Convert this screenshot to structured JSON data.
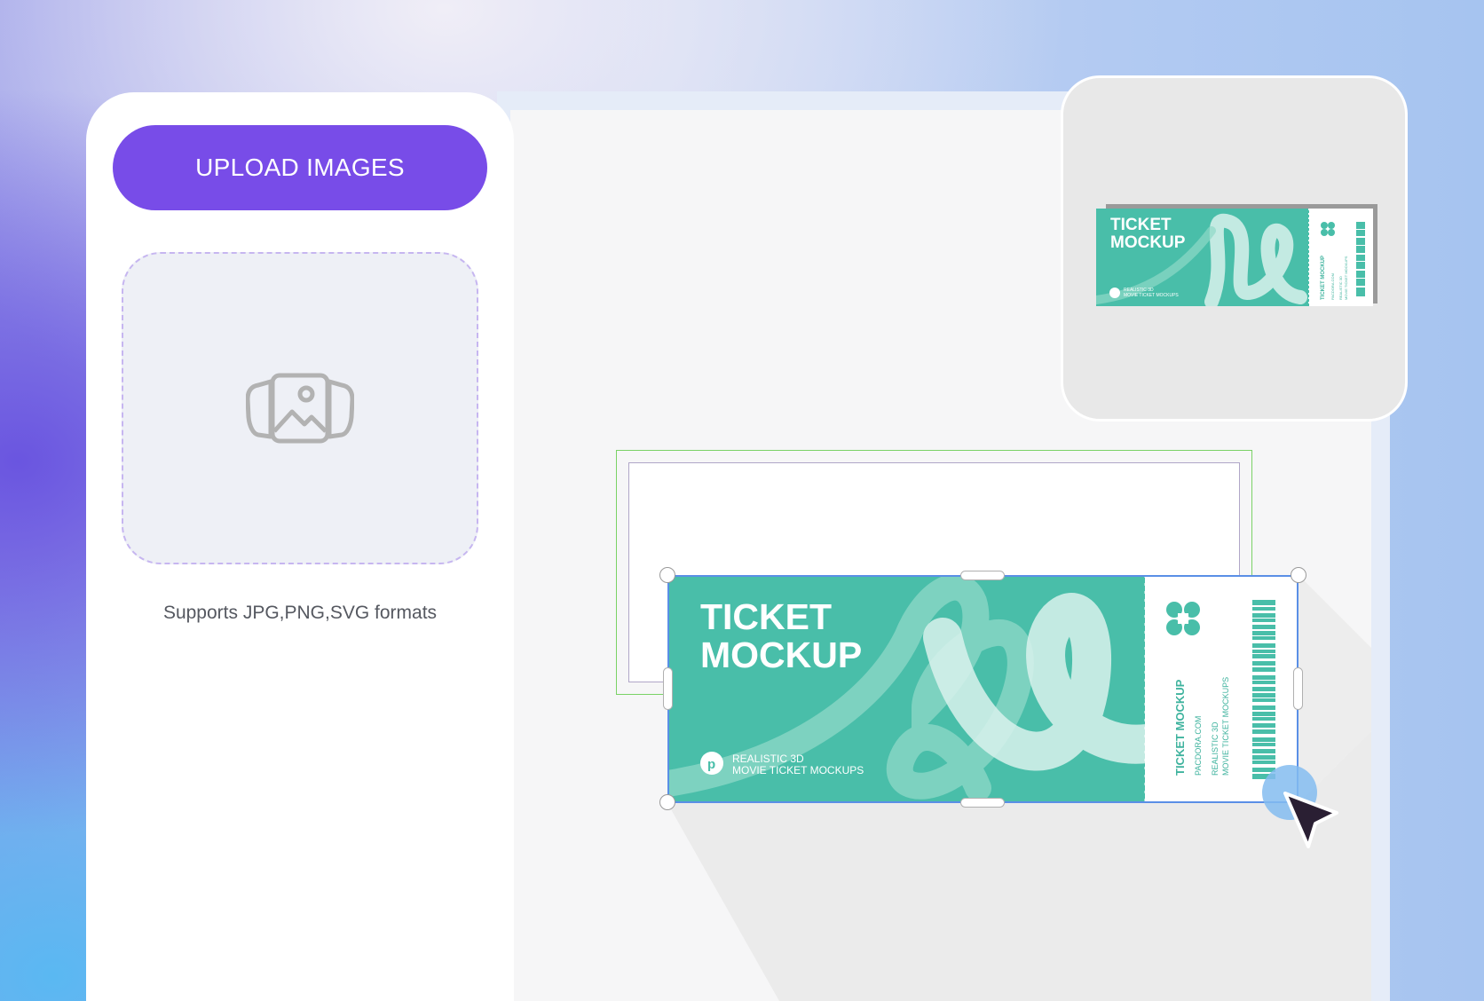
{
  "upload_panel": {
    "button_label": "UPLOAD IMAGES",
    "drop_zone_icon": "images-icon",
    "formats_hint": "Supports JPG,PNG,SVG formats"
  },
  "main_ticket": {
    "title_line1": "TICKET",
    "title_line2": "MOCKUP",
    "subtitle_line1": "REALISTIC 3D",
    "subtitle_line2": "MOVIE TICKET MOCKUPS",
    "stub_title": "TICKET MOCKUP",
    "stub_site": "PACDORA.COM",
    "stub_line1": "REALISTIC 3D",
    "stub_line2": "MOVIE TICKET MOCKUPS",
    "logo_icon": "pacdora-logo-icon",
    "clover_icon": "clover-icon"
  },
  "preview_card": {
    "title_line1": "TICKET",
    "title_line2": "MOCKUP",
    "subtitle_line1": "REALISTIC 3D",
    "subtitle_line2": "MOVIE TICKET MOCKUPS",
    "stub_title": "TICKET MOCKUP",
    "stub_site": "PACDORA.COM",
    "stub_line1": "REALISTIC 3D",
    "stub_line2": "MOVIE TICKET MOCKUPS"
  },
  "colors": {
    "accent": "#784ce8",
    "ticket_green": "#49bea9",
    "selection_blue": "#5a8fe6",
    "placement_green": "#7ad266"
  },
  "cursor_icon": "pointer-cursor-icon"
}
